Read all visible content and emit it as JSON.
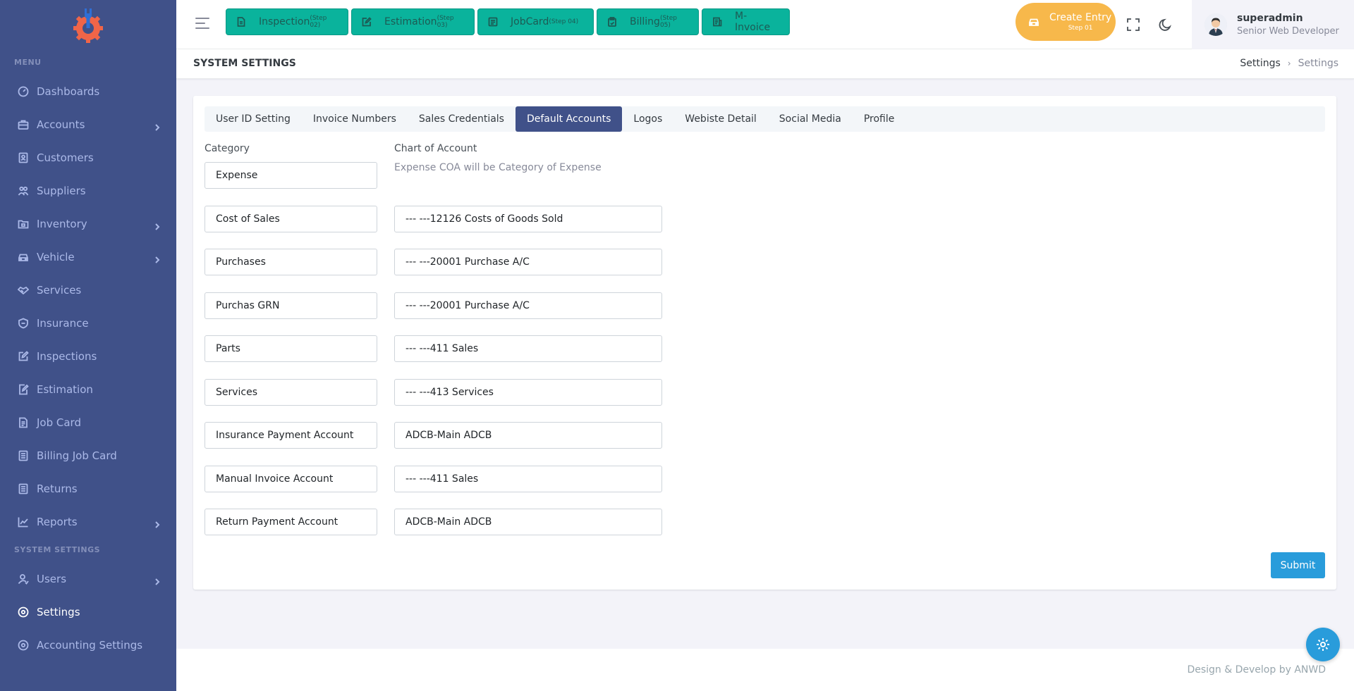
{
  "colors": {
    "sidebar_bg": "#405189",
    "accent_green": "#0ab39c",
    "accent_yellow": "#f7b84b",
    "primary": "#405189",
    "submit_blue": "#299cdb"
  },
  "sidebar": {
    "menu_title": "MENU",
    "items": [
      {
        "label": "Dashboards",
        "icon": "dashboard-icon",
        "has_children": false
      },
      {
        "label": "Accounts",
        "icon": "briefcase-icon",
        "has_children": true
      },
      {
        "label": "Customers",
        "icon": "contact-icon",
        "has_children": false
      },
      {
        "label": "Suppliers",
        "icon": "users-icon",
        "has_children": false
      },
      {
        "label": "Inventory",
        "icon": "folder-icon",
        "has_children": true
      },
      {
        "label": "Vehicle",
        "icon": "car-icon",
        "has_children": true
      },
      {
        "label": "Services",
        "icon": "handshake-icon",
        "has_children": false
      },
      {
        "label": "Insurance",
        "icon": "shield-icon",
        "has_children": false
      },
      {
        "label": "Inspections",
        "icon": "edit-icon",
        "has_children": false
      },
      {
        "label": "Estimation",
        "icon": "estimate-icon",
        "has_children": false
      },
      {
        "label": "Job Card",
        "icon": "file-icon",
        "has_children": false
      },
      {
        "label": "Billing Job Card",
        "icon": "list-icon",
        "has_children": false
      },
      {
        "label": "Returns",
        "icon": "list-icon",
        "has_children": false
      },
      {
        "label": "Reports",
        "icon": "chart-icon",
        "has_children": true
      }
    ],
    "settings_title": "SYSTEM SETTINGS",
    "settings_items": [
      {
        "label": "Users",
        "icon": "user-icon",
        "has_children": true
      },
      {
        "label": "Settings",
        "icon": "settings-icon",
        "has_children": false,
        "active": true
      },
      {
        "label": "Accounting Settings",
        "icon": "settings-icon",
        "has_children": false
      }
    ]
  },
  "topbar": {
    "steps": [
      {
        "label": "Inspection",
        "step": "(Step 02)"
      },
      {
        "label": "Estimation",
        "step": "(Step 03)"
      },
      {
        "label": "JobCard",
        "step": "(Step 04)"
      },
      {
        "label": "Billing",
        "step": "(Step 05)"
      },
      {
        "label": "M-Invoice",
        "step": ""
      }
    ],
    "create_entry": {
      "label": "Create Entry",
      "sub": "Step 01"
    },
    "user": {
      "name": "superadmin",
      "role": "Senior Web Developer"
    }
  },
  "page": {
    "title": "SYSTEM SETTINGS",
    "breadcrumb": [
      "Settings",
      "Settings"
    ]
  },
  "tabs": [
    {
      "label": "User ID Setting"
    },
    {
      "label": "Invoice Numbers"
    },
    {
      "label": "Sales Credentials"
    },
    {
      "label": "Default Accounts",
      "active": true
    },
    {
      "label": "Logos"
    },
    {
      "label": "Webiste Detail"
    },
    {
      "label": "Social Media"
    },
    {
      "label": "Profile"
    }
  ],
  "form": {
    "category_label": "Category",
    "coa_label": "Chart of Account",
    "expense": {
      "category": "Expense",
      "hint": "Expense COA will be Category of Expense"
    },
    "rows": [
      {
        "category": "Cost of Sales",
        "account": "--- ---12126 Costs of Goods Sold"
      },
      {
        "category": "Purchases",
        "account": "--- ---20001 Purchase A/C"
      },
      {
        "category": "Purchas GRN",
        "account": "--- ---20001 Purchase A/C"
      },
      {
        "category": "Parts",
        "account": "--- ---411 Sales"
      },
      {
        "category": "Services",
        "account": "--- ---413 Services"
      },
      {
        "category": "Insurance Payment Account",
        "account": "ADCB-Main ADCB"
      },
      {
        "category": "Manual Invoice Account",
        "account": "--- ---411 Sales"
      },
      {
        "category": "Return Payment Account",
        "account": "ADCB-Main ADCB"
      }
    ],
    "submit_label": "Submit"
  },
  "footer": {
    "text": "Design & Develop by ANWD"
  }
}
